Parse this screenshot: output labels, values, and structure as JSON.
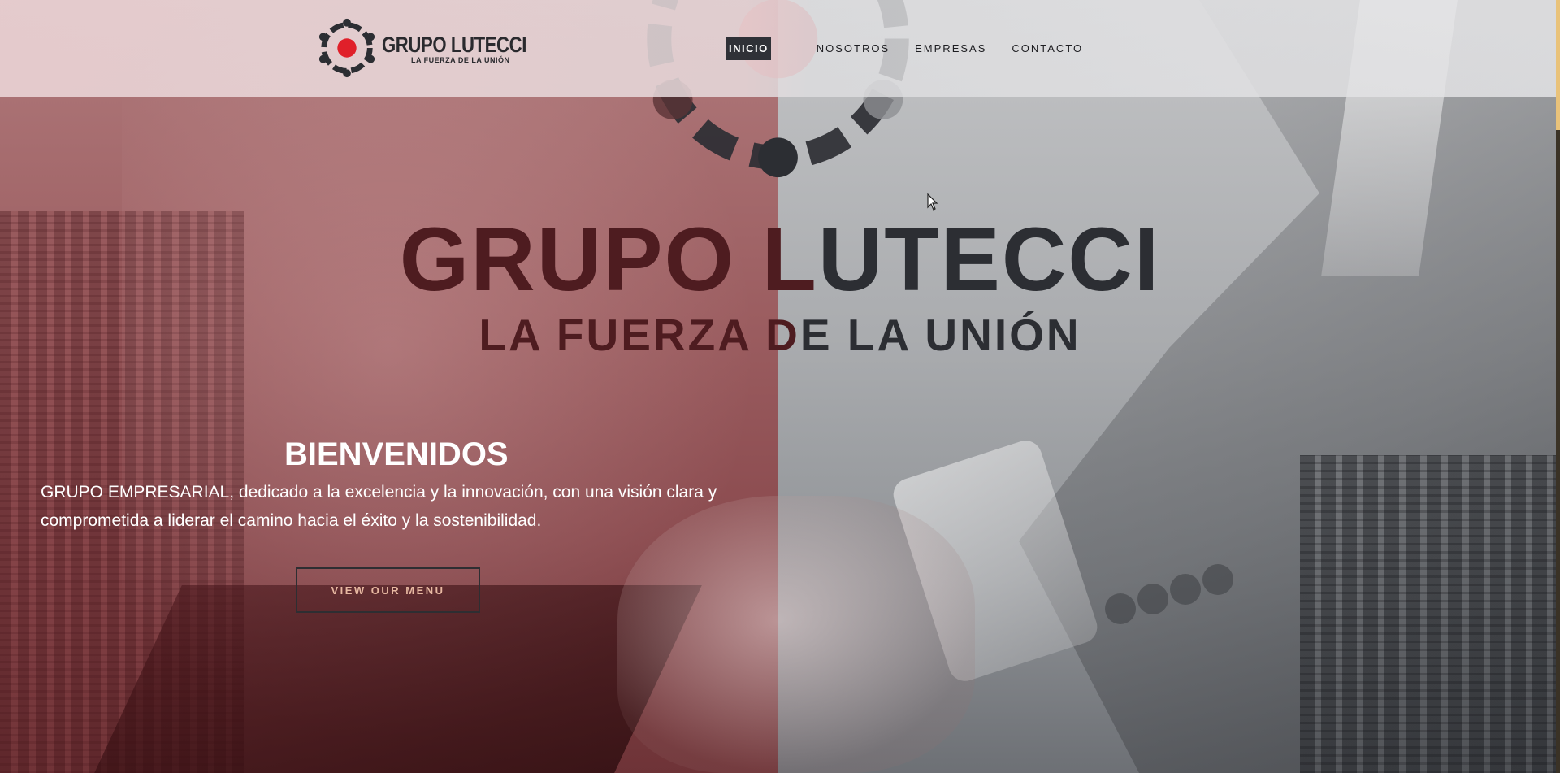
{
  "header": {
    "logo": {
      "name": "GRUPO LUTECCI",
      "tagline": "LA FUERZA DE LA UNIÓN",
      "icon": "ring-logo-icon"
    },
    "nav": [
      {
        "label": "INICIO",
        "active": true
      },
      {
        "label": "NOSOTROS",
        "active": false
      },
      {
        "label": "EMPRESAS",
        "active": false
      },
      {
        "label": "CONTACTO",
        "active": false
      }
    ]
  },
  "hero": {
    "headline_a": "GRUPO L",
    "headline_b": "UTECCI",
    "subheadline_a": "LA FUERZA D",
    "subheadline_b": "E LA UNIÓN",
    "welcome_title": "BIENVENIDOS",
    "welcome_text": "GRUPO EMPRESARIAL, dedicado a la excelencia y la innovación, con una visión clara y comprometida a liderar el camino hacia el éxito y la sostenibilidad.",
    "cta_label": "VIEW OUR MENU"
  },
  "colors": {
    "accent_red": "#e0202a",
    "dark": "#2c2e33",
    "maroon": "#4e1c20",
    "nav_active_bg": "#2f3137",
    "cta_text": "#e8b9a2"
  }
}
